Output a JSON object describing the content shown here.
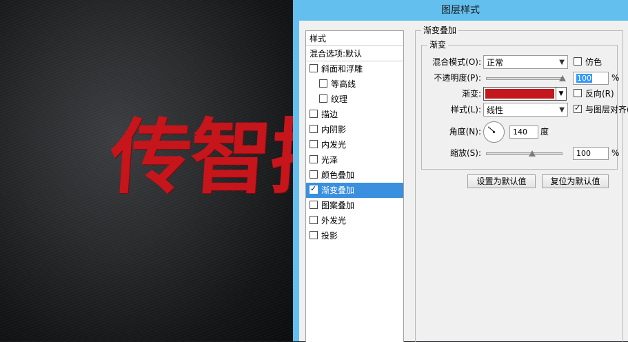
{
  "canvas": {
    "art_text": "传智插"
  },
  "dialog": {
    "title": "图层样式",
    "style_list": {
      "header": "样式",
      "blend_options": "混合选项:默认",
      "items": [
        {
          "label": "斜面和浮雕",
          "checked": false
        },
        {
          "label": "等高线",
          "checked": false
        },
        {
          "label": "纹理",
          "checked": false
        },
        {
          "label": "描边",
          "checked": false
        },
        {
          "label": "内阴影",
          "checked": false
        },
        {
          "label": "内发光",
          "checked": false
        },
        {
          "label": "光泽",
          "checked": false
        },
        {
          "label": "颜色叠加",
          "checked": false
        },
        {
          "label": "渐变叠加",
          "checked": true,
          "selected": true
        },
        {
          "label": "图案叠加",
          "checked": false
        },
        {
          "label": "外发光",
          "checked": false
        },
        {
          "label": "投影",
          "checked": false
        }
      ]
    },
    "panel": {
      "section_title": "渐变叠加",
      "group_title": "渐变",
      "blend_mode_label": "混合模式(O):",
      "blend_mode_value": "正常",
      "dither_label": "仿色",
      "dither_checked": false,
      "opacity_label": "不透明度(P):",
      "opacity_value": "100",
      "opacity_unit": "%",
      "gradient_label": "渐变:",
      "gradient_color": "#c2181e",
      "reverse_label": "反向(R)",
      "reverse_checked": false,
      "style_label": "样式(L):",
      "style_value": "线性",
      "align_label": "与图层对齐(I)",
      "align_checked": true,
      "angle_label": "角度(N):",
      "angle_value": "140",
      "angle_unit": "度",
      "scale_label": "缩放(S):",
      "scale_value": "100",
      "scale_unit": "%",
      "btn_make_default": "设置为默认值",
      "btn_reset_default": "复位为默认值"
    }
  },
  "colors": {
    "title_bar": "#62bfee",
    "selection": "#3a8fde",
    "text_red": "#c6151b"
  }
}
